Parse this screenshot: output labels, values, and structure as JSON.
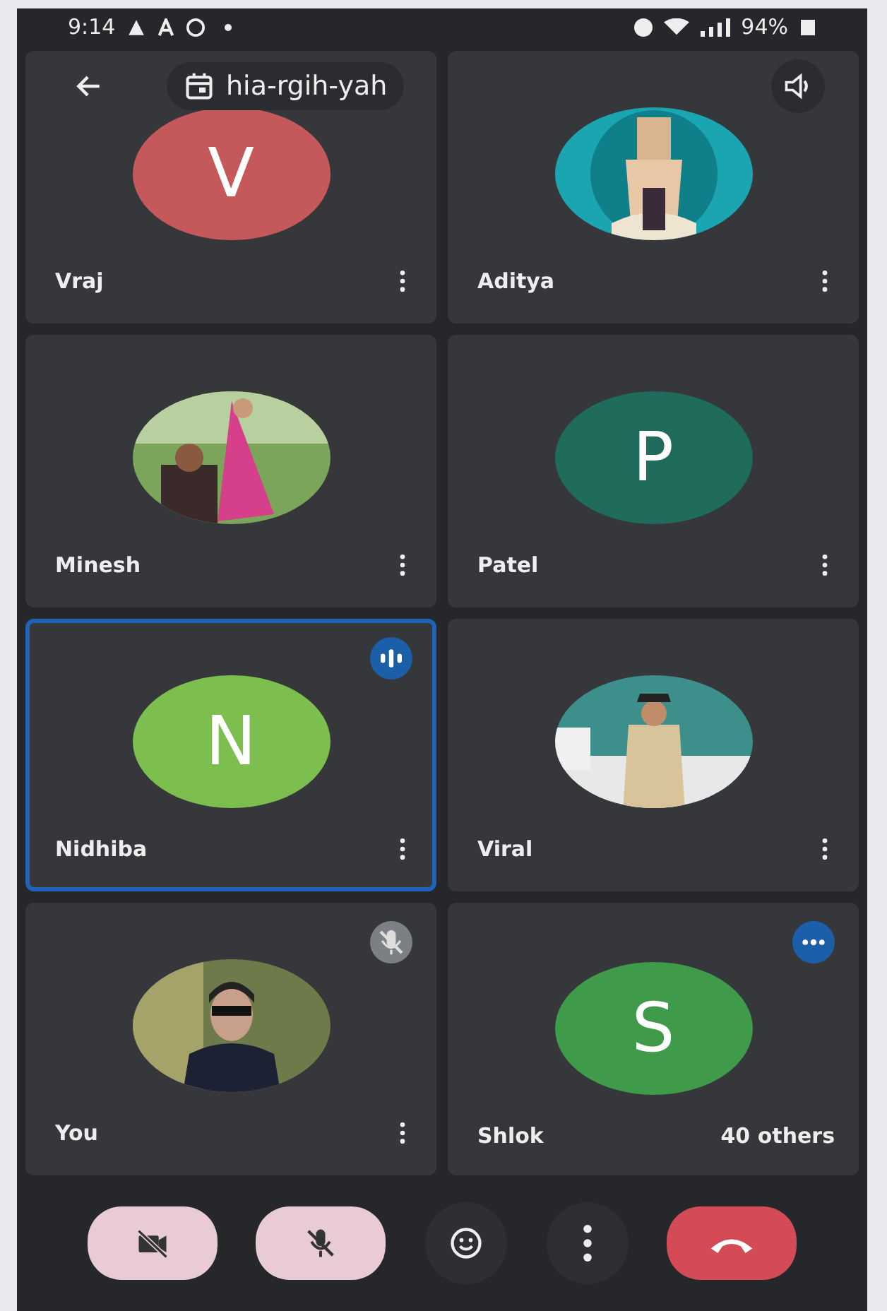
{
  "status_bar": {
    "time": "9:14",
    "battery": "94%"
  },
  "header": {
    "meeting_code": "hia-rgih-yah"
  },
  "tiles": [
    {
      "name": "Vraj",
      "avatar": {
        "kind": "letter",
        "letter": "V",
        "color": "#c4585a"
      },
      "active": false
    },
    {
      "name": "Aditya",
      "active": false
    },
    {
      "name": "Minesh",
      "active": false
    },
    {
      "name": "Patel",
      "avatar": {
        "kind": "letter",
        "letter": "P",
        "color": "#1f6b5c"
      },
      "active": false
    },
    {
      "name": "Nidhiba",
      "avatar": {
        "kind": "letter",
        "letter": "N",
        "color": "#7cbf4e"
      },
      "indicator": {
        "kind": "speaking"
      },
      "active": true
    },
    {
      "name": "Viral",
      "active": false
    },
    {
      "name": "You",
      "indicator": {
        "kind": "muted"
      },
      "active": false
    },
    {
      "name": "Shlok",
      "avatar": {
        "kind": "letter",
        "letter": "S",
        "color": "#3f9a4a"
      },
      "indicator": {
        "kind": "dots"
      },
      "active": false,
      "others": "40 others"
    }
  ],
  "controls": [
    {
      "kind": "camera-off"
    },
    {
      "kind": "mic-off"
    },
    {
      "kind": "emoji"
    },
    {
      "kind": "more"
    },
    {
      "kind": "end-call"
    }
  ]
}
